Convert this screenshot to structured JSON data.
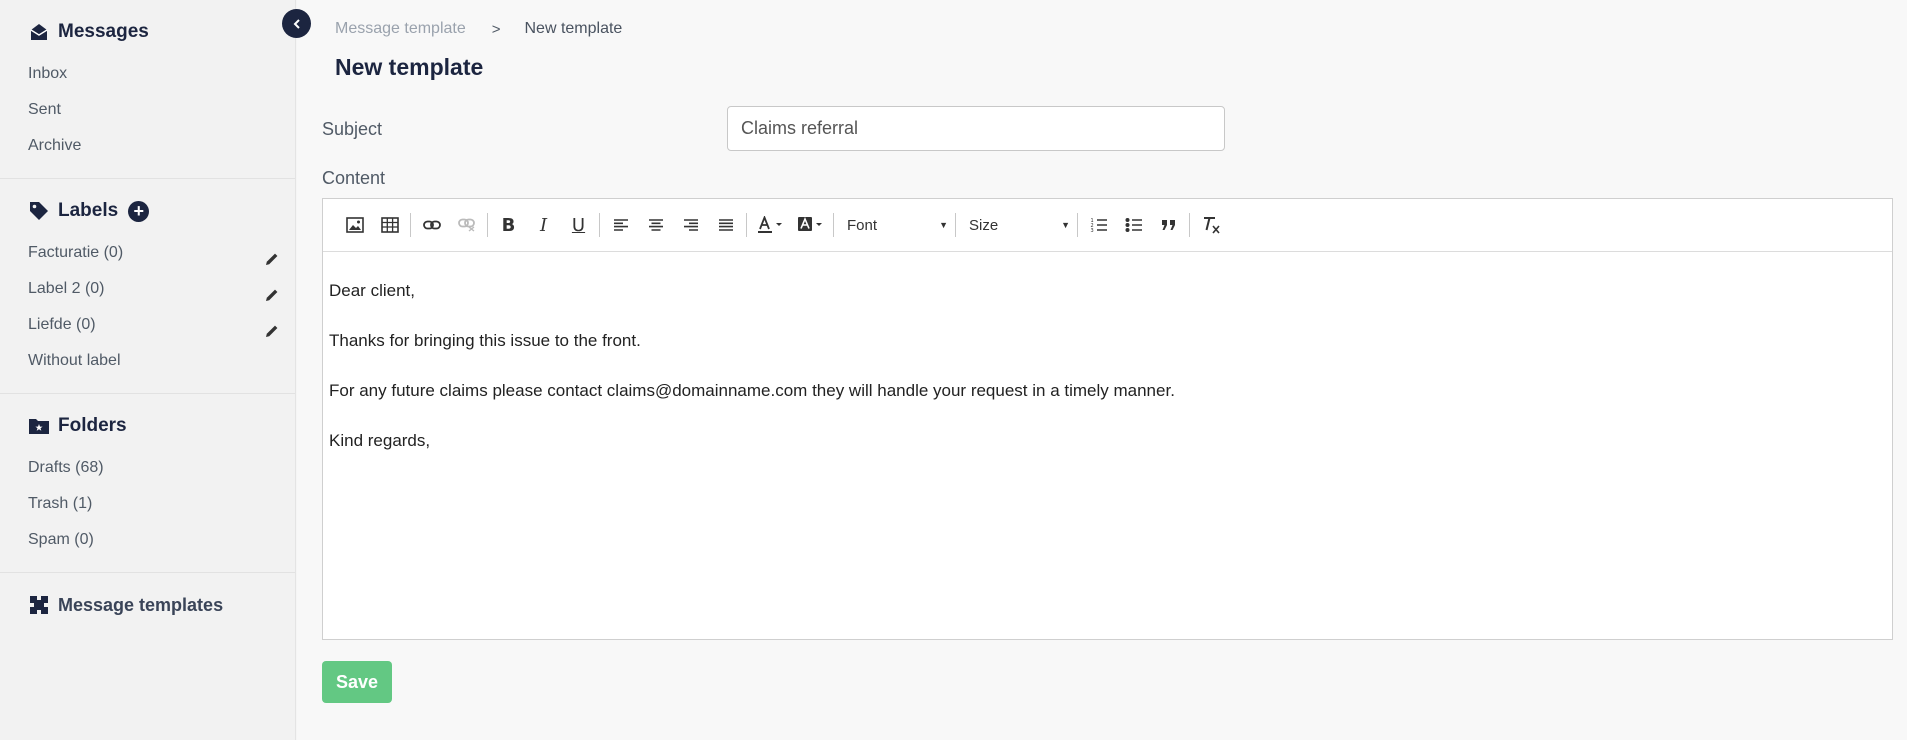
{
  "sidebar": {
    "messages": {
      "title": "Messages",
      "icon": "envelope-open-icon",
      "items": [
        {
          "label": "Inbox"
        },
        {
          "label": "Sent"
        },
        {
          "label": "Archive"
        }
      ]
    },
    "labels": {
      "title": "Labels",
      "icon": "tag-icon",
      "add_icon": "plus-circle-icon",
      "items": [
        {
          "label": "Facturatie (0)",
          "editable": true
        },
        {
          "label": "Label 2 (0)",
          "editable": true
        },
        {
          "label": "Liefde (0)",
          "editable": true
        },
        {
          "label": "Without label",
          "editable": false
        }
      ]
    },
    "folders": {
      "title": "Folders",
      "icon": "folder-star-icon",
      "items": [
        {
          "label": "Drafts (68)"
        },
        {
          "label": "Trash (1)"
        },
        {
          "label": "Spam (0)"
        }
      ]
    },
    "templates": {
      "title": "Message templates",
      "icon": "puzzle-icon"
    },
    "collapse_icon": "chevron-left-icon"
  },
  "breadcrumb": {
    "parent": "Message template",
    "separator": ">",
    "current": "New template"
  },
  "page_title": "New template",
  "form": {
    "subject_label": "Subject",
    "subject_value": "Claims referral",
    "content_label": "Content",
    "font_select": "Font",
    "size_select": "Size",
    "body": [
      "Dear client,",
      "Thanks for bringing this issue to the front.",
      "For any future claims please contact claims@domainname.com they will handle your request in a timely manner.",
      "Kind regards,"
    ],
    "save_label": "Save"
  },
  "colors": {
    "navy": "#1c2540",
    "save_green": "#63c883"
  }
}
